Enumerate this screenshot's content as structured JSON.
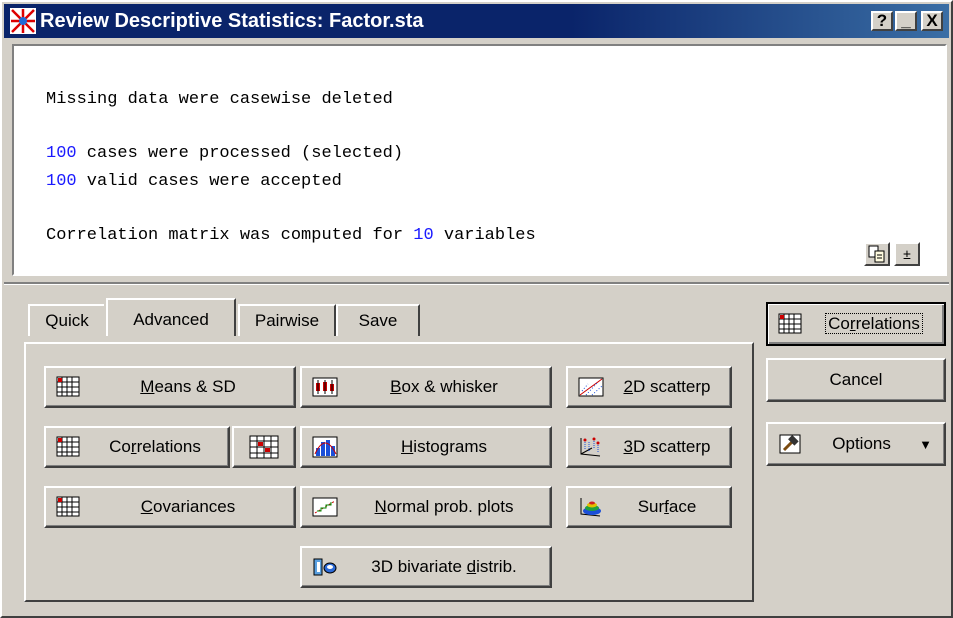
{
  "window": {
    "title": "Review Descriptive Statistics: Factor.sta",
    "caption_buttons": {
      "help": "?",
      "minimize": "_",
      "close": "X"
    }
  },
  "output": {
    "line1": "Missing data were casewise deleted",
    "line2_num": "100",
    "line2_text": " cases were processed (selected)",
    "line3_num": "100",
    "line3_text": " valid cases were accepted",
    "line4_text_a": "Correlation matrix was computed for ",
    "line4_num": "10",
    "line4_text_b": " variables",
    "scroll_up_glyph": "±"
  },
  "tabs": [
    {
      "label": "Quick"
    },
    {
      "label": "Advanced",
      "active": true
    },
    {
      "label": "Pairwise"
    },
    {
      "label": "Save"
    }
  ],
  "buttons": {
    "means_sd": {
      "pre": "",
      "u": "M",
      "post": "eans & SD"
    },
    "correlations": {
      "pre": "Co",
      "u": "r",
      "post": "relations"
    },
    "covariances": {
      "pre": "",
      "u": "C",
      "post": "ovariances"
    },
    "box_whisker": {
      "pre": "",
      "u": "B",
      "post": "ox & whisker"
    },
    "histograms": {
      "pre": "",
      "u": "H",
      "post": "istograms"
    },
    "normal_prob": {
      "pre": "",
      "u": "N",
      "post": "ormal prob. plots"
    },
    "bivariate": {
      "pre": "3D  bivariate ",
      "u": "d",
      "post": "istrib."
    },
    "scatter2d": {
      "pre": "",
      "u": "2",
      "post": "D scatterp"
    },
    "scatter3d": {
      "pre": "",
      "u": "3",
      "post": "D scatterp"
    },
    "surface": {
      "pre": "Sur",
      "u": "f",
      "post": "ace"
    }
  },
  "side_buttons": {
    "correlations": {
      "pre": "Co",
      "u": "r",
      "post": "relations"
    },
    "cancel": "Cancel",
    "options": "Options",
    "options_arrow": "▼"
  },
  "colors": {
    "title_bar": "#0a246a",
    "face": "#d4d0c8",
    "number_blue": "#1a1aff"
  }
}
